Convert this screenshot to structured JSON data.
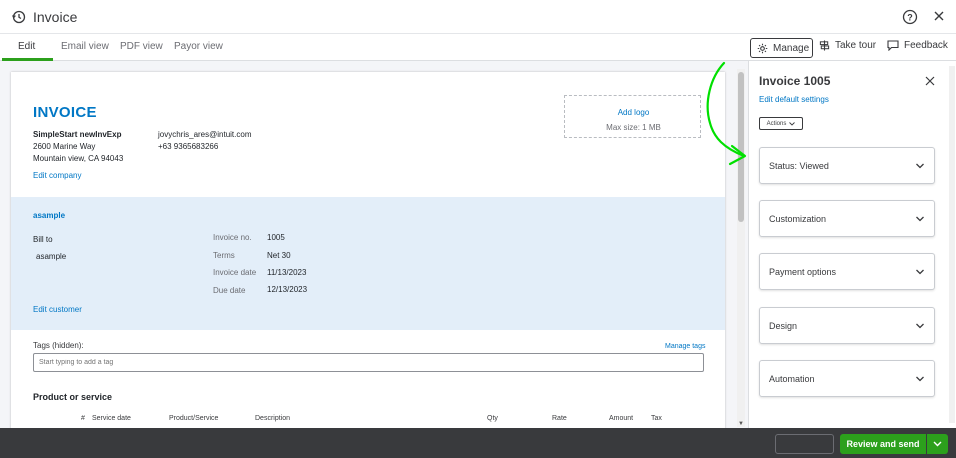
{
  "window": {
    "title": "Invoice"
  },
  "tabs": [
    {
      "label": "Edit"
    },
    {
      "label": "Email view"
    },
    {
      "label": "PDF view"
    },
    {
      "label": "Payor view"
    }
  ],
  "toolbar": {
    "manage_label": "Manage",
    "take_tour_label": "Take tour",
    "feedback_label": "Feedback"
  },
  "invoice": {
    "heading": "INVOICE",
    "company": {
      "name": "SimpleStart newInvExp",
      "street": "2600 Marine Way",
      "city_line": "Mountain view, CA 94043",
      "email": "jovychris_ares@intuit.com",
      "phone": "+63 9365683266",
      "edit_label": "Edit company"
    },
    "logo": {
      "add_label": "Add logo",
      "max_size": "Max size: 1 MB"
    },
    "customer": {
      "name": "asample",
      "bill_to_label": "Bill to",
      "bill_to_name": "asample",
      "edit_label": "Edit customer"
    },
    "meta": {
      "invoice_no_label": "Invoice no.",
      "invoice_no": "1005",
      "terms_label": "Terms",
      "terms": "Net 30",
      "invoice_date_label": "Invoice date",
      "invoice_date": "11/13/2023",
      "due_date_label": "Due date",
      "due_date": "12/13/2023"
    },
    "tags": {
      "label": "Tags (hidden):",
      "manage_label": "Manage tags",
      "placeholder": "Start typing to add a tag"
    },
    "products": {
      "heading": "Product or service",
      "columns": [
        "#",
        "Service date",
        "Product/Service",
        "Description",
        "Qty",
        "Rate",
        "Amount",
        "Tax"
      ]
    }
  },
  "panel": {
    "title": "Invoice 1005",
    "edit_settings_label": "Edit default settings",
    "actions_label": "Actions",
    "sections": [
      "Status: Viewed",
      "Customization",
      "Payment options",
      "Design",
      "Automation"
    ]
  },
  "footer": {
    "review_label": "Review and send"
  },
  "colors": {
    "accent_green": "#2ca01c",
    "link_blue": "#0077c5",
    "annotation_green": "#00e000"
  }
}
